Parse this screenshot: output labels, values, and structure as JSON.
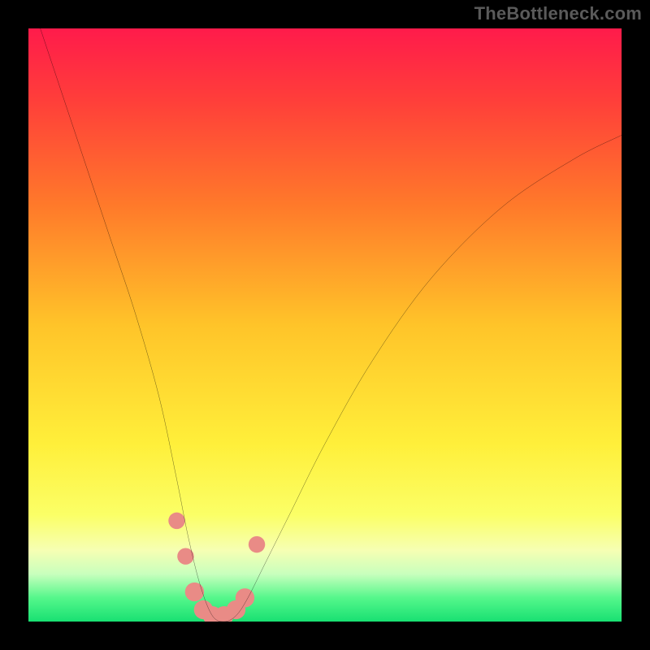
{
  "watermark": "TheBottleneck.com",
  "chart_data": {
    "type": "line",
    "title": "",
    "xlabel": "",
    "ylabel": "",
    "xlim": [
      0,
      100
    ],
    "ylim": [
      0,
      100
    ],
    "background_gradient_stops": [
      {
        "pct": 0,
        "color": "#ff1b4b"
      },
      {
        "pct": 12,
        "color": "#ff3e3a"
      },
      {
        "pct": 30,
        "color": "#ff7a2a"
      },
      {
        "pct": 50,
        "color": "#ffc429"
      },
      {
        "pct": 70,
        "color": "#ffef3a"
      },
      {
        "pct": 82,
        "color": "#fbff66"
      },
      {
        "pct": 88,
        "color": "#f6ffb3"
      },
      {
        "pct": 92,
        "color": "#c8ffbd"
      },
      {
        "pct": 96,
        "color": "#55f78b"
      },
      {
        "pct": 100,
        "color": "#18e072"
      }
    ],
    "series": [
      {
        "name": "bottleneck-curve",
        "x": [
          2,
          6,
          10,
          14,
          18,
          22,
          25,
          27,
          29,
          31,
          33,
          35,
          37,
          40,
          44,
          50,
          58,
          68,
          80,
          92,
          100
        ],
        "y": [
          100,
          88,
          76,
          64,
          52,
          38,
          24,
          14,
          6,
          1,
          0,
          1,
          4,
          10,
          18,
          30,
          44,
          58,
          70,
          78,
          82
        ]
      }
    ],
    "markers": [
      {
        "name": "pink-marker",
        "x": 25.0,
        "y": 17,
        "r": 1.4,
        "color": "#e98b86"
      },
      {
        "name": "pink-marker",
        "x": 26.5,
        "y": 11,
        "r": 1.4,
        "color": "#e98b86"
      },
      {
        "name": "pink-marker",
        "x": 28.0,
        "y": 5,
        "r": 1.6,
        "color": "#e98b86"
      },
      {
        "name": "pink-marker",
        "x": 29.5,
        "y": 2,
        "r": 1.6,
        "color": "#e98b86"
      },
      {
        "name": "pink-marker",
        "x": 31.0,
        "y": 1,
        "r": 1.6,
        "color": "#e98b86"
      },
      {
        "name": "pink-marker",
        "x": 33.0,
        "y": 1,
        "r": 1.6,
        "color": "#e98b86"
      },
      {
        "name": "pink-marker",
        "x": 35.0,
        "y": 2,
        "r": 1.6,
        "color": "#e98b86"
      },
      {
        "name": "pink-marker",
        "x": 36.5,
        "y": 4,
        "r": 1.6,
        "color": "#e98b86"
      },
      {
        "name": "pink-marker",
        "x": 38.5,
        "y": 13,
        "r": 1.4,
        "color": "#e98b86"
      }
    ]
  }
}
